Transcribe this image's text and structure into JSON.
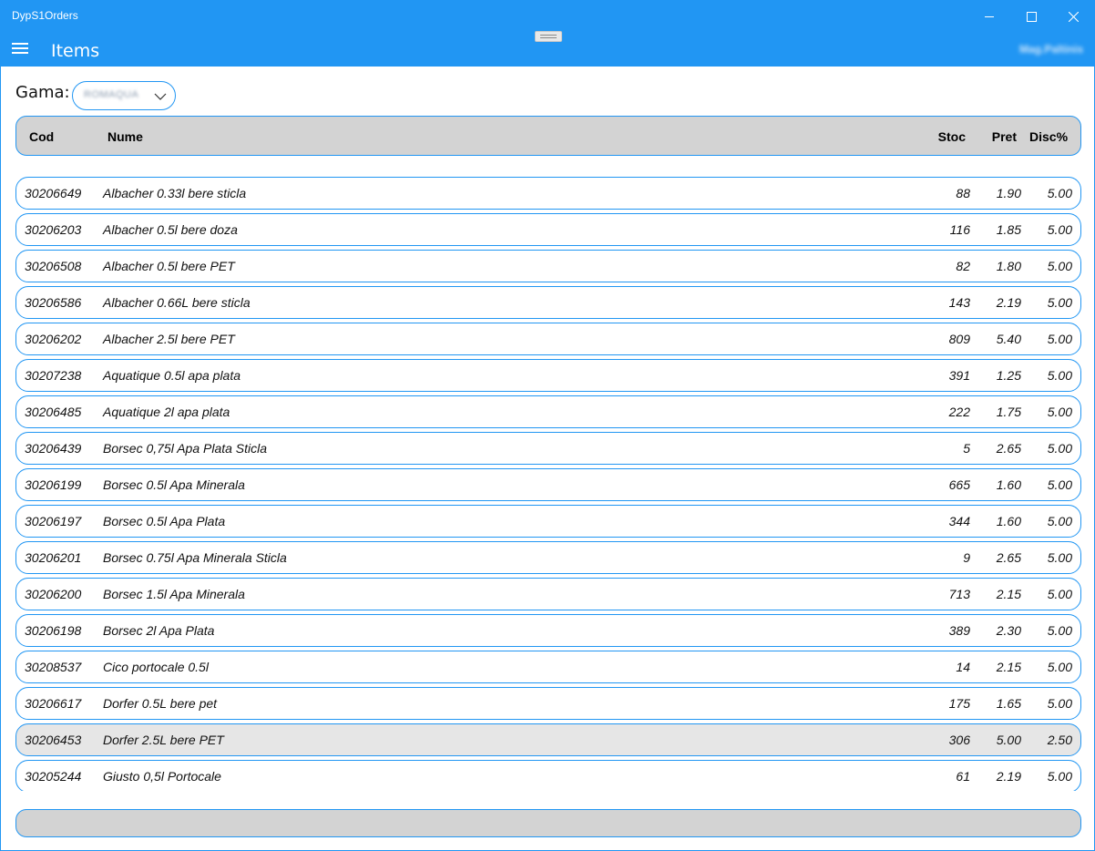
{
  "app": {
    "title": "DypS1Orders",
    "page_title": "Items",
    "user": "Mag.Paltinis",
    "accent": "#2196f3"
  },
  "window_controls": {
    "minimize_icon": "minimize-icon",
    "maximize_icon": "maximize-icon",
    "close_icon": "close-icon"
  },
  "filter": {
    "label": "Gama:",
    "selected": "ROMAQUA"
  },
  "table": {
    "headers": {
      "cod": "Cod",
      "nume": "Nume",
      "stoc": "Stoc",
      "pret": "Pret",
      "disc": "Disc%"
    },
    "rows": [
      {
        "cod": "30206649",
        "nume": "Albacher 0.33l bere sticla",
        "stoc": "88",
        "pret": "1.90",
        "disc": "5.00"
      },
      {
        "cod": "30206203",
        "nume": "Albacher 0.5l bere doza",
        "stoc": "116",
        "pret": "1.85",
        "disc": "5.00"
      },
      {
        "cod": "30206508",
        "nume": "Albacher 0.5l bere PET",
        "stoc": "82",
        "pret": "1.80",
        "disc": "5.00"
      },
      {
        "cod": "30206586",
        "nume": "Albacher 0.66L bere sticla",
        "stoc": "143",
        "pret": "2.19",
        "disc": "5.00"
      },
      {
        "cod": "30206202",
        "nume": "Albacher 2.5l bere PET",
        "stoc": "809",
        "pret": "5.40",
        "disc": "5.00"
      },
      {
        "cod": "30207238",
        "nume": "Aquatique 0.5l apa plata",
        "stoc": "391",
        "pret": "1.25",
        "disc": "5.00"
      },
      {
        "cod": "30206485",
        "nume": "Aquatique 2l apa plata",
        "stoc": "222",
        "pret": "1.75",
        "disc": "5.00"
      },
      {
        "cod": "30206439",
        "nume": "Borsec 0,75l Apa Plata Sticla",
        "stoc": "5",
        "pret": "2.65",
        "disc": "5.00"
      },
      {
        "cod": "30206199",
        "nume": "Borsec 0.5l Apa Minerala",
        "stoc": "665",
        "pret": "1.60",
        "disc": "5.00"
      },
      {
        "cod": "30206197",
        "nume": "Borsec 0.5l Apa Plata",
        "stoc": "344",
        "pret": "1.60",
        "disc": "5.00"
      },
      {
        "cod": "30206201",
        "nume": "Borsec 0.75l Apa Minerala Sticla",
        "stoc": "9",
        "pret": "2.65",
        "disc": "5.00"
      },
      {
        "cod": "30206200",
        "nume": "Borsec 1.5l Apa Minerala",
        "stoc": "713",
        "pret": "2.15",
        "disc": "5.00"
      },
      {
        "cod": "30206198",
        "nume": "Borsec 2l Apa Plata",
        "stoc": "389",
        "pret": "2.30",
        "disc": "5.00"
      },
      {
        "cod": "30208537",
        "nume": "Cico portocale 0.5l",
        "stoc": "14",
        "pret": "2.15",
        "disc": "5.00"
      },
      {
        "cod": "30206617",
        "nume": "Dorfer 0.5L bere pet",
        "stoc": "175",
        "pret": "1.65",
        "disc": "5.00"
      },
      {
        "cod": "30206453",
        "nume": "Dorfer 2.5L bere PET",
        "stoc": "306",
        "pret": "5.00",
        "disc": "2.50",
        "selected": true
      },
      {
        "cod": "30205244",
        "nume": "Giusto 0,5l Portocale",
        "stoc": "61",
        "pret": "2.19",
        "disc": "5.00"
      }
    ]
  }
}
